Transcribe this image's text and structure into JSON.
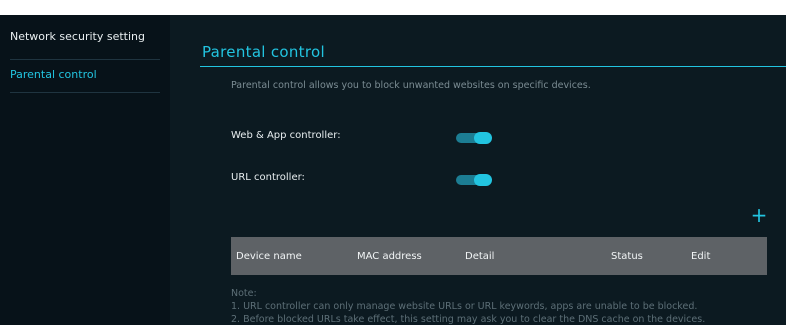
{
  "sidebar": {
    "items": [
      {
        "label": "Network security setting"
      },
      {
        "label": "Parental control",
        "active": true
      }
    ]
  },
  "main": {
    "title": "Parental control",
    "description": "Parental control allows you to block unwanted websites on specific devices.",
    "controls": [
      {
        "label": "Web & App controller:",
        "state": "on"
      },
      {
        "label": "URL controller:",
        "state": "on"
      }
    ],
    "add_icon": "plus-icon",
    "table": {
      "columns": [
        "Device name",
        "MAC address",
        "Detail",
        "Status",
        "Edit"
      ]
    },
    "note": {
      "heading": "Note:",
      "lines": [
        "1. URL controller can only manage website URLs or URL keywords, apps are unable to be blocked.",
        "2. Before blocked URLs take effect, this setting may ask you to clear the DNS cache on the devices."
      ]
    }
  },
  "colors": {
    "accent": "#22c4e0",
    "background": "#0c1a21",
    "sidebar": "#071219",
    "table_header": "#5e6266"
  }
}
